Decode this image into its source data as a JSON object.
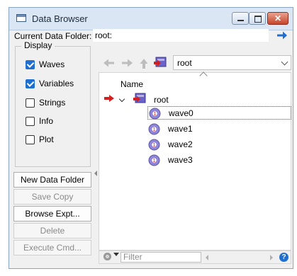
{
  "window": {
    "title": "Data Browser",
    "controls": {
      "close_glyph": "✕"
    }
  },
  "folder": {
    "label": "Current Data Folder:",
    "path": "root:"
  },
  "display": {
    "legend": "Display",
    "options": [
      {
        "label": "Waves",
        "checked": true
      },
      {
        "label": "Variables",
        "checked": true
      },
      {
        "label": "Strings",
        "checked": false
      },
      {
        "label": "Info",
        "checked": false
      },
      {
        "label": "Plot",
        "checked": false
      }
    ]
  },
  "buttons": {
    "new_data_folder": "New Data Folder",
    "save_copy": "Save Copy",
    "browse_expt": "Browse Expt...",
    "delete": "Delete",
    "execute_cmd": "Execute Cmd..."
  },
  "nav": {
    "folder_select": "root"
  },
  "tree": {
    "column_header": "Name",
    "root_label": "root",
    "selected_index": 0,
    "waves": [
      "wave0",
      "wave1",
      "wave2",
      "wave3"
    ]
  },
  "filter": {
    "placeholder": "Filter",
    "help_glyph": "?"
  },
  "colors": {
    "accent": "#1f6fd0",
    "titlebar": "#dbe6f4",
    "close_button": "#c7442a",
    "current_folder_arrow": "#d21f1f"
  }
}
